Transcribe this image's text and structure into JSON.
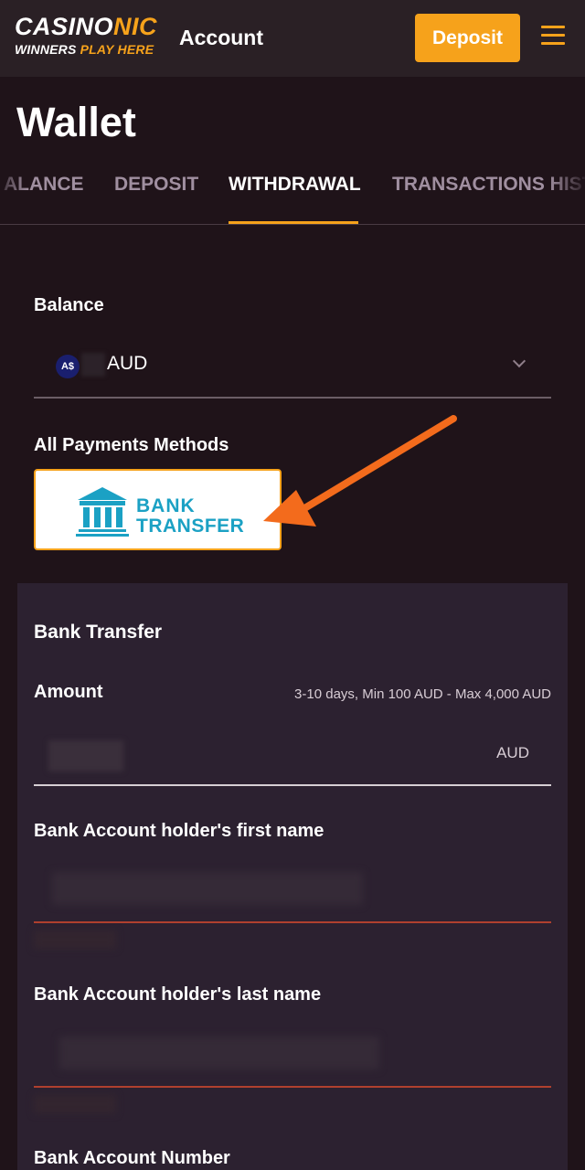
{
  "header": {
    "logo": {
      "main_white": "CASINO",
      "main_orange": "NIC",
      "sub_white": "WINNERS ",
      "sub_orange": "PLAY HERE"
    },
    "title": "Account",
    "deposit_label": "Deposit"
  },
  "page": {
    "title": "Wallet"
  },
  "tabs": [
    {
      "label": "ALANCE",
      "active": false
    },
    {
      "label": "DEPOSIT",
      "active": false
    },
    {
      "label": "WITHDRAWAL",
      "active": true
    },
    {
      "label": "TRANSACTIONS HIST",
      "active": false
    }
  ],
  "balance": {
    "label": "Balance",
    "currency_icon": "A$",
    "currency_code": "AUD"
  },
  "payments": {
    "label": "All Payments Methods",
    "methods": [
      {
        "line1": "BANK",
        "line2": "TRANSFER",
        "selected": true
      }
    ]
  },
  "form": {
    "title": "Bank Transfer",
    "amount": {
      "label": "Amount",
      "hint": "3-10 days, Min 100 AUD - Max 4,000 AUD",
      "currency": "AUD"
    },
    "first_name": {
      "label": "Bank Account holder's first name"
    },
    "last_name": {
      "label": "Bank Account holder's last name"
    },
    "account_number": {
      "label": "Bank Account Number"
    }
  },
  "colors": {
    "accent": "#f6a21b",
    "background": "#1f1319",
    "panel": "#2c2130",
    "bank_blue": "#1ba1c4",
    "error_line": "#b0402e",
    "arrow": "#f36b1c"
  }
}
